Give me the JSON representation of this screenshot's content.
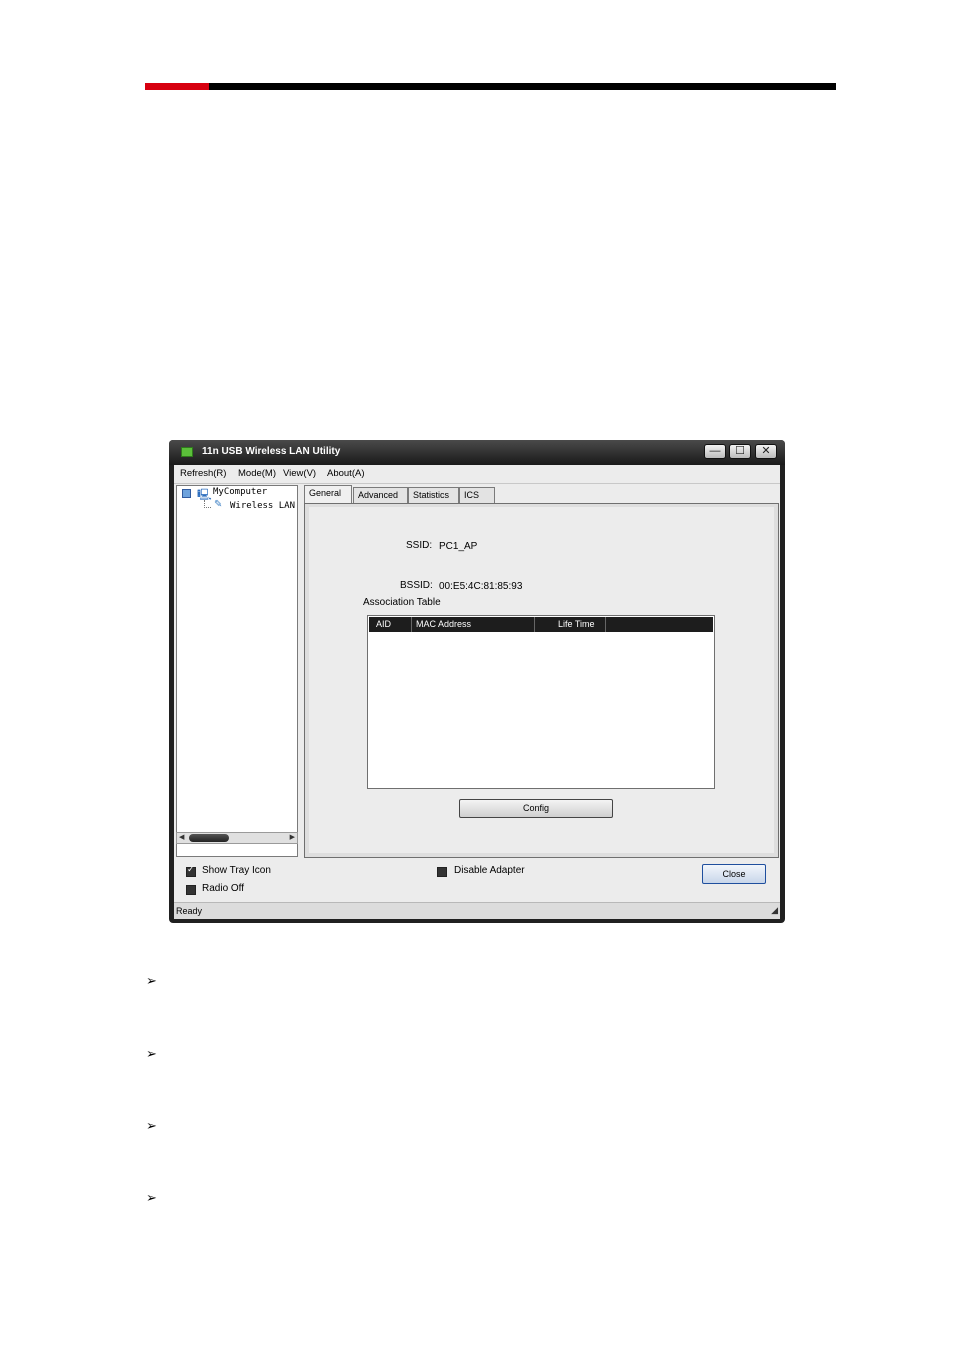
{
  "window": {
    "title": "11n USB Wireless LAN Utility",
    "controls": {
      "minimize": "—",
      "maximize": "☐",
      "close": "✕"
    }
  },
  "menu": [
    "Refresh(R)",
    "Mode(M)",
    "View(V)",
    "About(A)"
  ],
  "tree": {
    "root": "MyComputer",
    "child": "Wireless LAN"
  },
  "tabs": [
    "General",
    "Advanced",
    "Statistics",
    "ICS"
  ],
  "general": {
    "ssid_label": "SSID:",
    "ssid_value": "PC1_AP",
    "bssid_label": "BSSID:",
    "bssid_value": "00:E5:4C:81:85:93",
    "assoc_title": "Association Table",
    "columns": [
      "AID",
      "MAC Address",
      "Life Time"
    ],
    "config_button": "Config"
  },
  "options": {
    "show_tray_icon": "Show Tray Icon",
    "radio_off": "Radio Off",
    "disable_adapter": "Disable Adapter",
    "close_button": "Close"
  },
  "status": "Ready",
  "bullets": [
    "➢",
    "➢",
    "➢",
    "➢"
  ],
  "colors": {
    "accent_red": "#d7000f",
    "header_black": "#000000"
  }
}
